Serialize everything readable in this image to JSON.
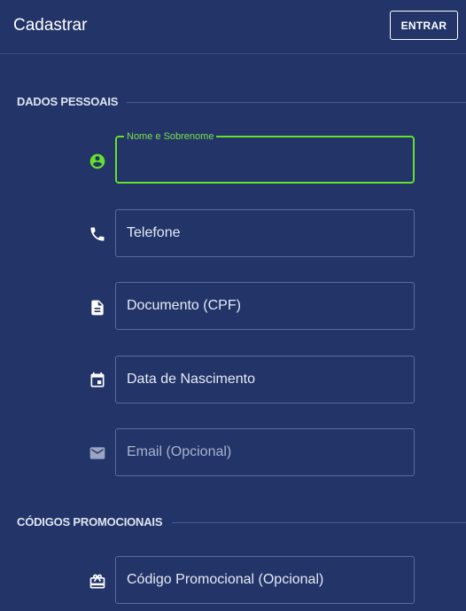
{
  "header": {
    "title": "Cadastrar",
    "login_button": "ENTRAR"
  },
  "sections": {
    "personal": "DADOS PESSOAIS",
    "promo": "CÓDIGOS PROMOCIONAIS"
  },
  "fields": {
    "name": {
      "label": "Nome e Sobrenome",
      "value": "",
      "icon": "account-circle-icon"
    },
    "phone": {
      "label": "Telefone",
      "icon": "phone-icon"
    },
    "document": {
      "label": "Documento (CPF)",
      "icon": "document-icon"
    },
    "birth": {
      "label": "Data de Nascimento",
      "icon": "calendar-icon"
    },
    "email": {
      "label": "Email (Opcional)",
      "icon": "email-icon"
    },
    "promo": {
      "label": "Código Promocional (Opcional)",
      "icon": "gift-icon"
    }
  },
  "colors": {
    "background": "#223468",
    "accent": "#66e02c",
    "border": "#5a6ba3"
  }
}
